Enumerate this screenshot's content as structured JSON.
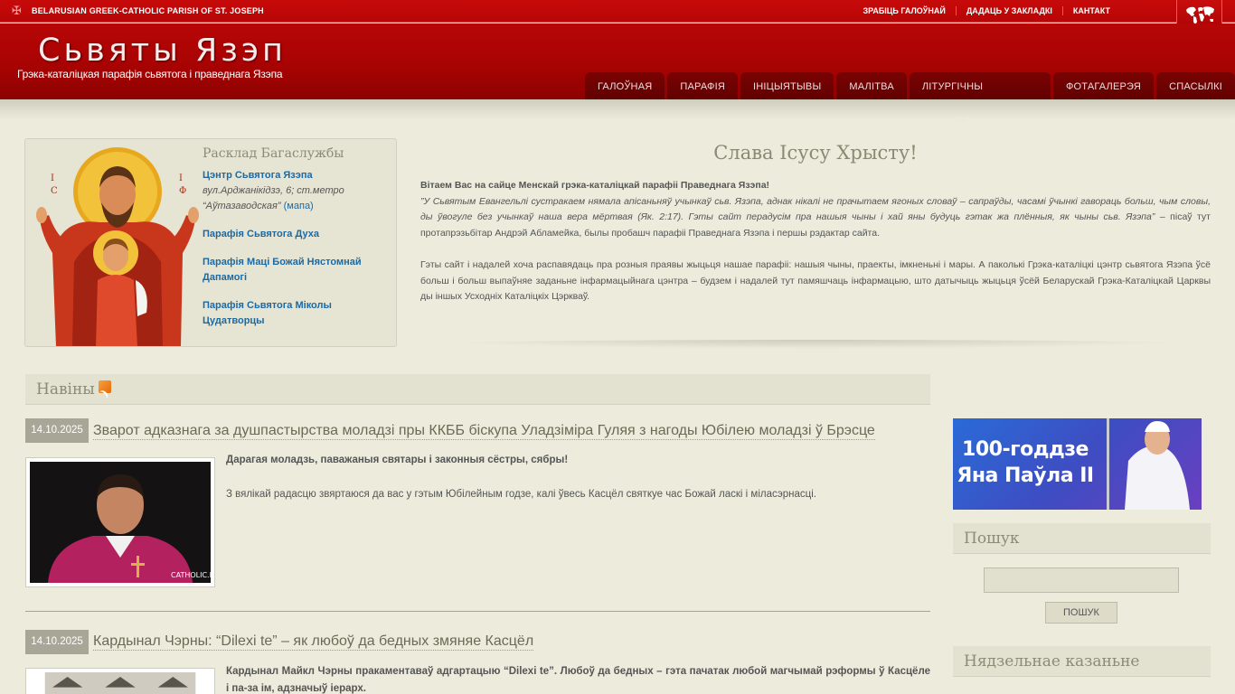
{
  "topbar": {
    "site_name_en": "BELARUSIAN GREEK-CATHOLIC PARISH OF ST. JOSEPH",
    "links": [
      "ЗРАБІЦЬ ГАЛОЎНАЙ",
      "ДАДАЦЬ У ЗАКЛАДКІ",
      "КАНТАКТ"
    ]
  },
  "header": {
    "title": "Сьвяты Язэп",
    "subtitle": "Грэка-каталіцкая парафія сьвятога і праведнага Язэпа",
    "nav": [
      "ГАЛОЎНАЯ",
      "ПАРАФІЯ",
      "ІНІЦЫЯТЫВЫ",
      "МАЛІТВА",
      "ЛІТУРГІЧНЫ КАЛЯНДАР",
      "ФОТАГАЛЕРЭЯ",
      "СПАСЫЛКІ"
    ]
  },
  "schedule": {
    "title": "Расклад Багаслужбы",
    "items": [
      {
        "name": "Цэнтр Сьвятога Язэпа",
        "address": "вул.Арджанікідзэ, 6; ст.метро “Аўтазаводская”",
        "map": "(мапа)"
      },
      {
        "name": "Парафія Сьвятога Духа"
      },
      {
        "name": "Парафія Маці Божай Нястомнай Дапамогі"
      },
      {
        "name": "Парафія Сьвятога Міколы Цудатворцы"
      }
    ]
  },
  "intro": {
    "greeting": "Слава Ісусу Хрысту!",
    "welcome": "Вітаем Вас на сайце Менскай грэка-каталіцкай парафіі Праведнага Язэпа!",
    "quote": "”У Сьвятым Евангельлі сустракаем нямала апісаньняў учынкаў сьв. Язэпа, аднак нікалі не прачытаем ягоных словаў – сапраўды, часамі ўчынкі гавораць больш, чым словы, ды ўвогуле без учынкаў наша вера мёртвая (Як. 2:17). Гэты сайт перадусім пра нашыя чыны і хай яны будуць гэтак жа плённыя, як чыны сьв. Язэпа”",
    "author": " – пісаў тут протапрэзьбітар Андрэй Абламейка, былы пробашч парафіі Праведнага Язэпа і першы рэдактар сайта.",
    "paragraph2": "Гэты сайт і надалей хоча распавядаць пра розныя праявы жыцьця нашае парафіі: нашыя чыны, праекты, імкненьні і мары. А паколькі Грэка-каталіцкі цэнтр сьвятога Язэпа ўсё больш і больш выпаўняе заданьне інфармацыйнага цэнтра – будзем і надалей тут памяшчаць інфармацыю, што датычыць жыцьця ўсёй Беларускай Грэка-Каталіцкай Царквы ды іншых Усходніх Каталіцкіх Цэркваў."
  },
  "news": {
    "heading": "Навіны",
    "items": [
      {
        "date": "14.10.2025",
        "title": "Зварот адказнага за душпастырства моладзі пры ККББ біскупа Уладзіміра Гуляя з нагоды Юбілею моладзі ў Брэсце",
        "lead": "Дарагая моладзь, паважаныя святары і законныя сёстры, сябры!",
        "text": "З вялікай радасцю звяртаюся да вас у гэтым Юбілейным годзе, калі ўвесь Касцёл святкуе час Божай ласкі і міласэрнасці.",
        "watermark": "CATHOLIC.BY"
      },
      {
        "date": "14.10.2025",
        "title": "Кардынал Чэрны: “Dilexi te” – як любоў да бедных змяняе Касцёл",
        "lead": "Кардынал Майкл Чэрны пракаментаваў адгартацыю “Dilexi te”. Любоў да бедных – гэта пачатак любой магчымай рэформы ў Касцёле і па-за ім, адзначыў іерарх."
      }
    ]
  },
  "sidebar": {
    "banner_line1": "100-годдзе",
    "banner_line2": "Яна Паўла II",
    "search_heading": "Пошук",
    "search_button": "ПОШУК",
    "sunday_heading": "Нядзельнае казаньне"
  },
  "colors": {
    "topbar": "#c70a0a",
    "header": "#a80303",
    "nav_tab": "#6e0101",
    "background": "#ecebdc",
    "link": "#1b6aa6",
    "date_badge": "#a8a797"
  }
}
